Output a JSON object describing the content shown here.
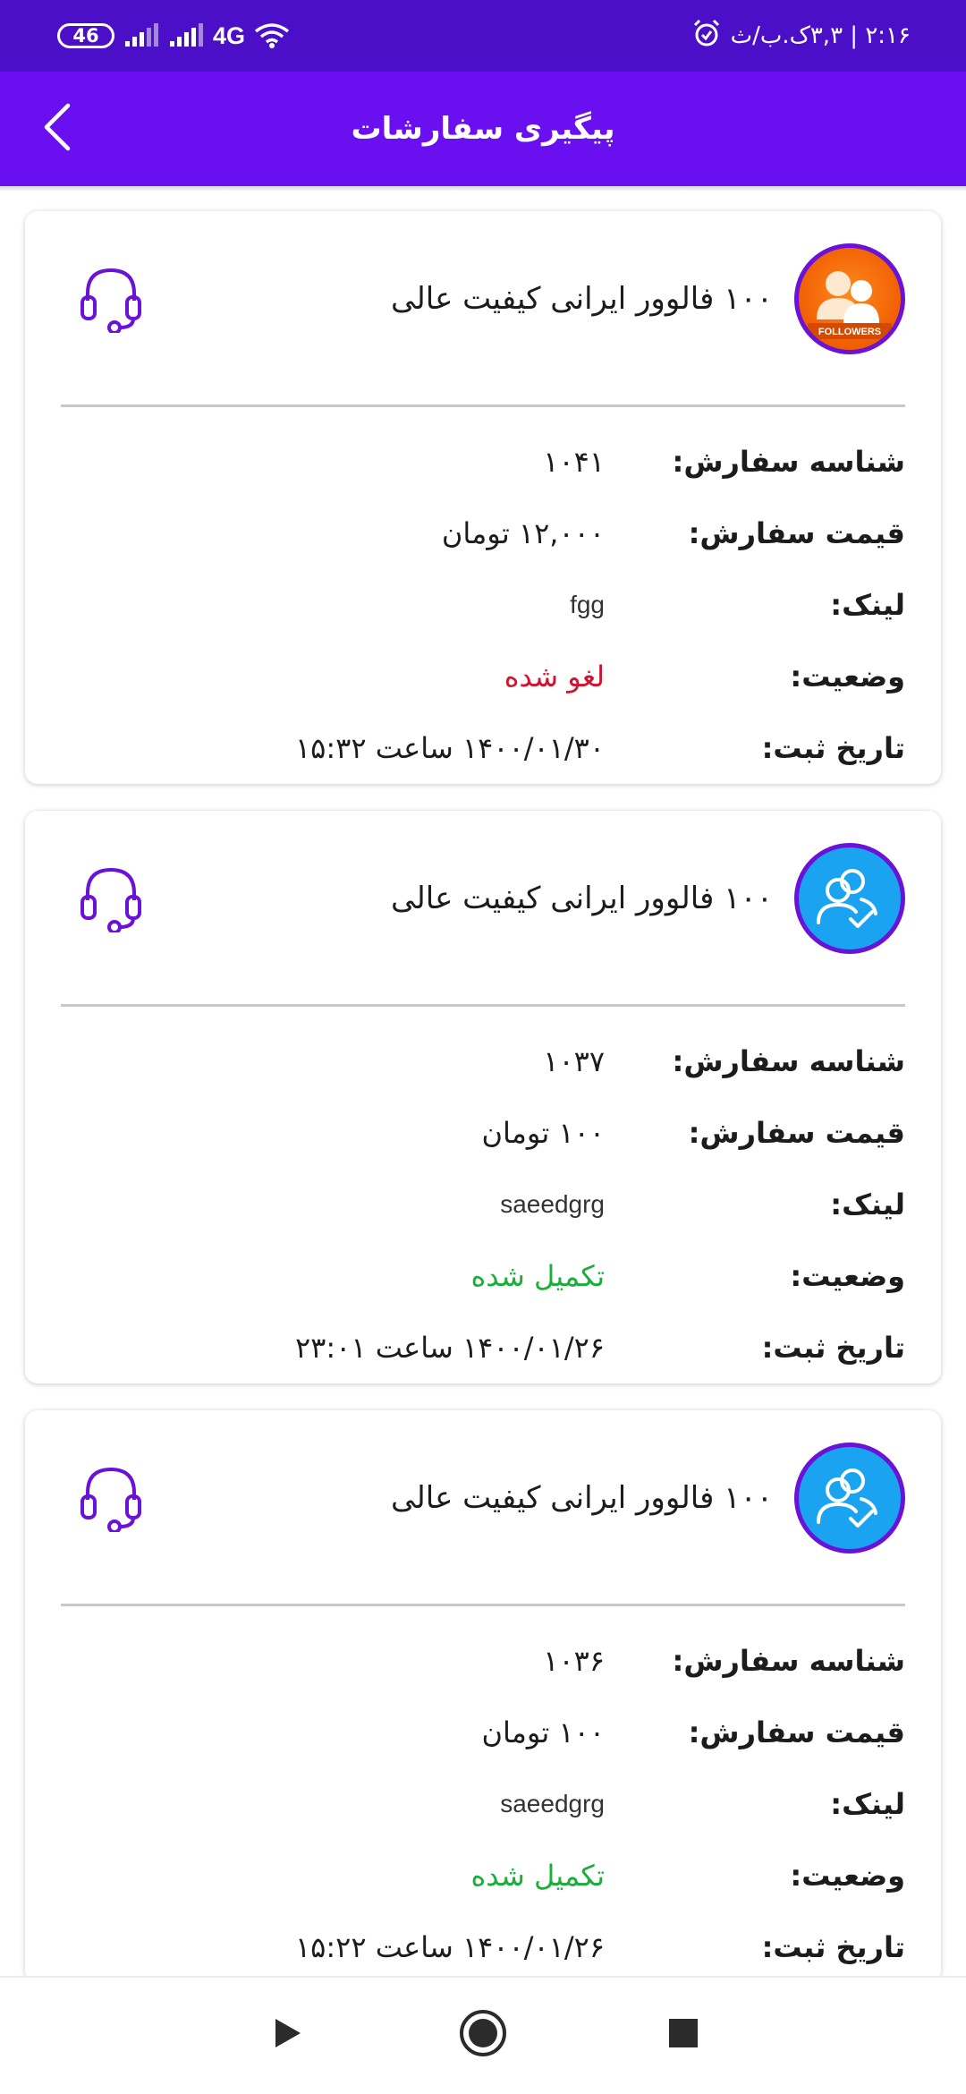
{
  "status_bar": {
    "battery": "46",
    "network": "4G",
    "time_date": "۲:۱۶ | ۳,۳ک.ب/ث"
  },
  "app_bar": {
    "title": "پیگیری سفارشات"
  },
  "labels": {
    "order_id": "شناسه سفارش:",
    "price": "قیمت سفارش:",
    "link": "لینک:",
    "status": "وضعیت:",
    "date": "تاریخ ثبت:"
  },
  "orders": [
    {
      "title": "۱۰۰ فالوور ایرانی کیفیت عالی",
      "avatar_icon": "followers-badge-icon",
      "avatar_badge_text": "FOLLOWERS",
      "order_id": "۱۰۴۱",
      "price": "۱۲,۰۰۰ تومان",
      "link": "fgg",
      "status": "لغو شده",
      "status_color": "#d01430",
      "date": "۱۴۰۰/۰۱/۳۰ ساعت ۱۵:۳۲"
    },
    {
      "title": "۱۰۰ فالوور ایرانی کیفیت عالی",
      "avatar_icon": "users-check-icon",
      "order_id": "۱۰۳۷",
      "price": "۱۰۰ تومان",
      "link": "saeedgrg",
      "status": "تکمیل شده",
      "status_color": "#1cad3a",
      "date": "۱۴۰۰/۰۱/۲۶ ساعت ۲۳:۰۱"
    },
    {
      "title": "۱۰۰ فالوور ایرانی کیفیت عالی",
      "avatar_icon": "users-check-icon",
      "order_id": "۱۰۳۶",
      "price": "۱۰۰ تومان",
      "link": "saeedgrg",
      "status": "تکمیل شده",
      "status_color": "#1cad3a",
      "date": "۱۴۰۰/۰۱/۲۶ ساعت ۱۵:۲۲"
    }
  ],
  "colors": {
    "status_bar": "#4a0fc7",
    "app_bar": "#6a0ff0",
    "accent_purple": "#6a12d8",
    "cancelled": "#d01430",
    "completed": "#1cad3a"
  }
}
